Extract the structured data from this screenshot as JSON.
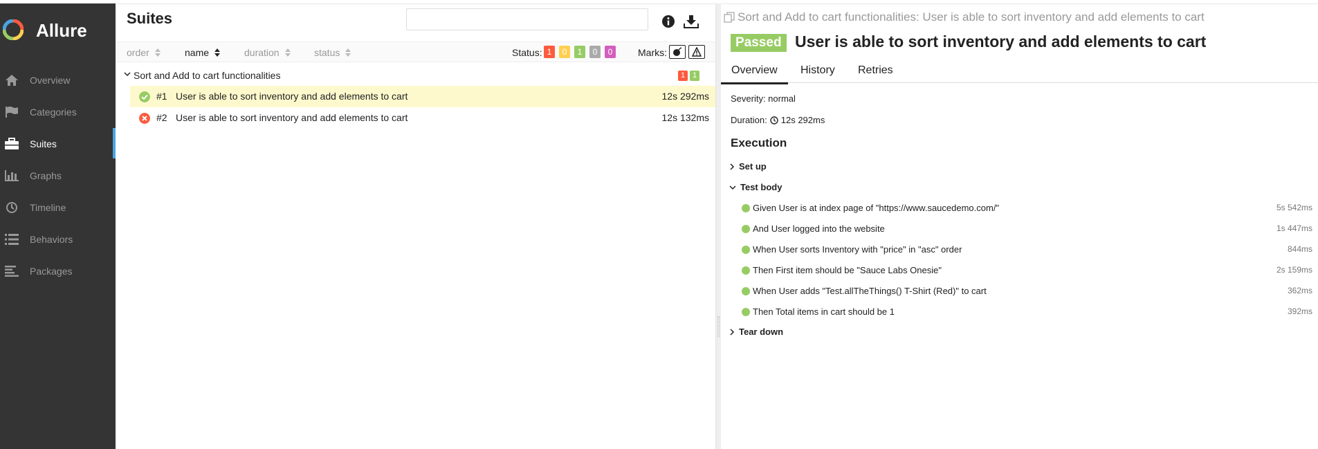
{
  "app": {
    "name": "Allure"
  },
  "sidebar": {
    "items": [
      {
        "label": "Overview",
        "icon": "home-icon"
      },
      {
        "label": "Categories",
        "icon": "flag-icon"
      },
      {
        "label": "Suites",
        "icon": "briefcase-icon",
        "active": true
      },
      {
        "label": "Graphs",
        "icon": "bar-chart-icon"
      },
      {
        "label": "Timeline",
        "icon": "clock-icon"
      },
      {
        "label": "Behaviors",
        "icon": "list-icon"
      },
      {
        "label": "Packages",
        "icon": "align-left-icon"
      }
    ]
  },
  "suites": {
    "title": "Suites",
    "search": {
      "placeholder": "",
      "value": ""
    },
    "sort_columns": [
      "order",
      "name",
      "duration",
      "status"
    ],
    "active_sort": "name",
    "status_label": "Status:",
    "status_counts": [
      {
        "count": "1",
        "color": "#fd5a3e",
        "status": "failed"
      },
      {
        "count": "0",
        "color": "#ffd050",
        "status": "broken"
      },
      {
        "count": "1",
        "color": "#97cc64",
        "status": "passed"
      },
      {
        "count": "0",
        "color": "#aaaaaa",
        "status": "skipped"
      },
      {
        "count": "0",
        "color": "#d35ebe",
        "status": "unknown"
      }
    ],
    "marks_label": "Marks:",
    "group": {
      "name": "Sort and Add to cart functionalities",
      "failed": "1",
      "passed": "1"
    },
    "rows": [
      {
        "num": "#1",
        "name": "User is able to sort inventory and add elements to cart",
        "duration": "12s 292ms",
        "status": "passed"
      },
      {
        "num": "#2",
        "name": "User is able to sort inventory and add elements to cart",
        "duration": "12s 132ms",
        "status": "failed"
      }
    ]
  },
  "detail": {
    "breadcrumb": "Sort and Add to cart functionalities: User is able to sort inventory and add elements to cart",
    "status": "Passed",
    "title": "User is able to sort inventory and add elements to cart",
    "tabs": [
      "Overview",
      "History",
      "Retries"
    ],
    "severity": "Severity: normal",
    "duration_label": "Duration:",
    "duration": "12s 292ms",
    "execution_heading": "Execution",
    "setup_label": "Set up",
    "body_label": "Test body",
    "teardown_label": "Tear down",
    "steps": [
      {
        "text": "Given User is at index page of \"https://www.saucedemo.com/\"",
        "duration": "5s 542ms"
      },
      {
        "text": "And User logged into the website",
        "duration": "1s 447ms"
      },
      {
        "text": "When User sorts Inventory with \"price\" in \"asc\" order",
        "duration": "844ms"
      },
      {
        "text": "Then First item should be \"Sauce Labs Onesie\"",
        "duration": "2s 159ms"
      },
      {
        "text": "When User adds \"Test.allTheThings() T-Shirt (Red)\" to cart",
        "duration": "362ms"
      },
      {
        "text": "Then Total items in cart should be 1",
        "duration": "392ms"
      }
    ]
  },
  "colors": {
    "passed": "#97cc64",
    "failed": "#fd5a3e",
    "sidebar": "#343434",
    "accent": "#4ba4e0"
  }
}
